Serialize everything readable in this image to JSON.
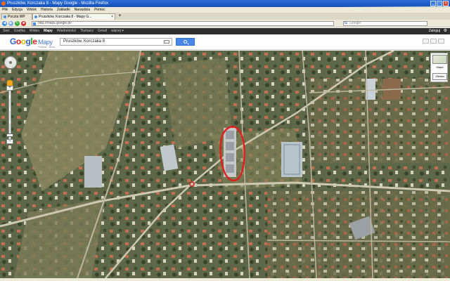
{
  "window": {
    "title": "Pruszków, Korczaka 8 - Mapy Google - Mozilla Firefox",
    "buttons": {
      "minimize": "_",
      "maximize": "□",
      "close": "×"
    }
  },
  "menu": [
    "Plik",
    "Edycja",
    "Widok",
    "Historia",
    "Zakładki",
    "Narzędzia",
    "Pomoc"
  ],
  "tabs": [
    {
      "label": "Poczta WP",
      "active": false
    },
    {
      "label": "Pruszków, Korczaka 8 - Mapy G...",
      "active": true
    }
  ],
  "new_tab": "+",
  "nav": {
    "url": "http://maps.google.pl/",
    "search_engine": "G",
    "search_placeholder": "Google"
  },
  "gbar": {
    "items": [
      "Sieć",
      "Grafika",
      "Wideo",
      "Mapy",
      "Wiadomości",
      "Tłumacz",
      "Gmail",
      "więcej ▾"
    ],
    "current": "Mapy",
    "login": "Zaloguj"
  },
  "header": {
    "logo_letters": [
      "G",
      "o",
      "o",
      "g",
      "l",
      "e"
    ],
    "logo_maps": "Mapy",
    "logo_sub": "Polska · Beta",
    "search_value": "Pruszków, Korczaka 8"
  },
  "map": {
    "controls": {
      "zoom_in": "+",
      "zoom_out": "–"
    },
    "type_buttons": {
      "primary": "Mapa",
      "secondary": "Ziemia"
    },
    "colors": {
      "annotation": "#e02020",
      "road": "#cfc8b0",
      "field": "#8a8760",
      "roof": "#c86a4a"
    }
  }
}
